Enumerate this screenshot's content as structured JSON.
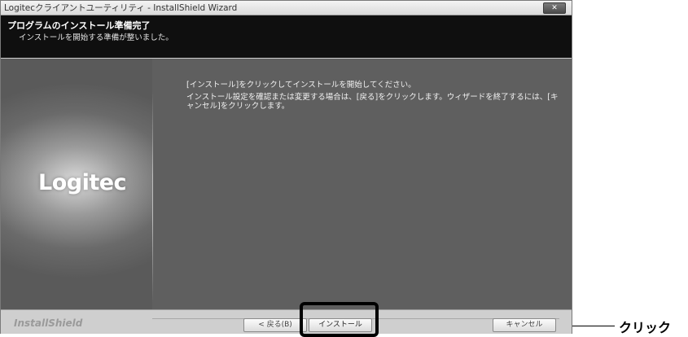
{
  "window": {
    "title": "Logitecクライアントユーティリティ - InstallShield Wizard",
    "close_label": "✕"
  },
  "header": {
    "title": "プログラムのインストール準備完了",
    "subtitle": "インストールを開始する準備が整いました。"
  },
  "main": {
    "logo_text": "Logitec",
    "message1": "[インストール]をクリックしてインストールを開始してください。",
    "message2": "インストール設定を確認または変更する場合は、[戻る]をクリックします。ウィザードを終了するには、[キャンセル]をクリックします。"
  },
  "footer": {
    "brand": "InstallShield",
    "back_label": "< 戻る(B)",
    "install_label": "インストール",
    "cancel_label": "キャンセル"
  },
  "annotation": {
    "label": "クリック"
  }
}
